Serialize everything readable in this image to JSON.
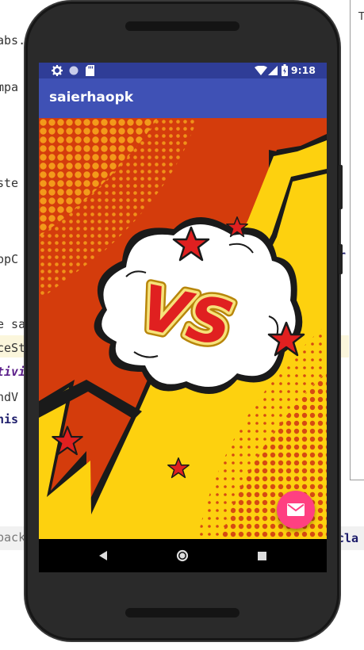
{
  "ide": {
    "lines": [
      "abs.",
      "mpa",
      "ste",
      "ppC",
      "e sa",
      "ceSt",
      "tivi",
      "ndV",
      "his",
      "back"
    ],
    "right_lines": [
      "r",
      "cla"
    ],
    "tick": "T"
  },
  "statusbar": {
    "time": "9:18",
    "icons_left": [
      "gear-icon",
      "circle-icon",
      "sd-card-icon"
    ],
    "icons_right": [
      "wifi-icon",
      "signal-icon",
      "battery-icon"
    ]
  },
  "appbar": {
    "title": "saierhaopk"
  },
  "content": {
    "vs_text": "VS",
    "colors": {
      "red": "#d43c0c",
      "yellow": "#fdd10f",
      "dot_orange": "#f39a1a",
      "star_red": "#e02020"
    }
  },
  "fab": {
    "icon": "mail-icon",
    "color": "#ff4081"
  },
  "navbar": {
    "buttons": [
      "back-icon",
      "home-icon",
      "recents-icon"
    ]
  }
}
